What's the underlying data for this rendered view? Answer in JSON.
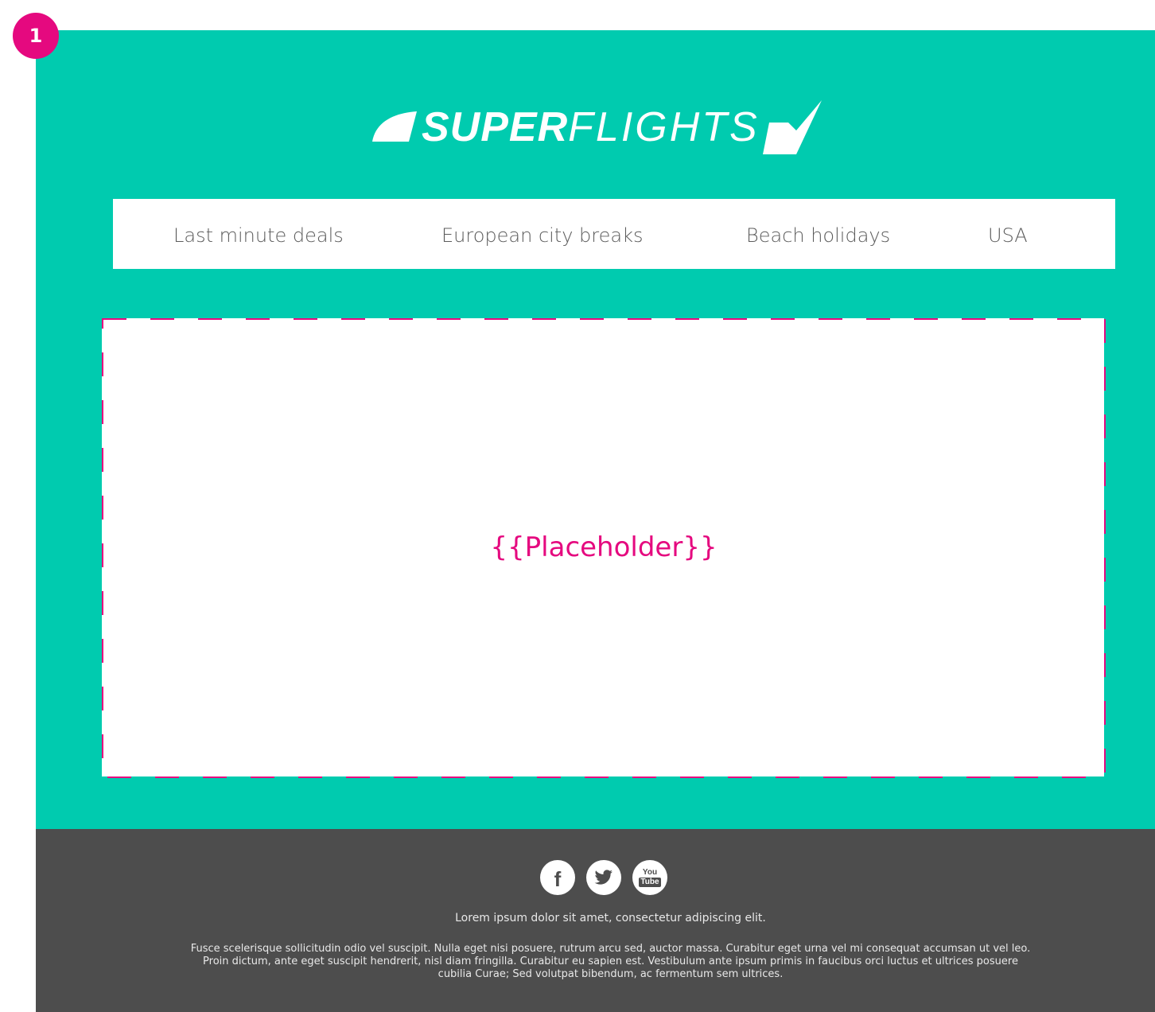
{
  "badge": {
    "number": "1"
  },
  "colors": {
    "teal": "#00cbaf",
    "accent_magenta": "#e5097f",
    "footer_bg": "#4d4d4d",
    "white": "#ffffff"
  },
  "header": {
    "logo": {
      "bold": "SUPER",
      "light": "FLIGHTS"
    }
  },
  "nav": {
    "items": [
      {
        "label": "Last minute deals"
      },
      {
        "label": "European city breaks"
      },
      {
        "label": "Beach holidays"
      },
      {
        "label": "USA"
      }
    ]
  },
  "main": {
    "placeholder": "{{Placeholder}}"
  },
  "footer": {
    "social": [
      {
        "icon": "facebook-icon",
        "glyph": "f"
      },
      {
        "icon": "twitter-icon"
      },
      {
        "icon": "youtube-icon",
        "top": "You",
        "bottom": "Tube"
      }
    ],
    "tagline": "Lorem ipsum dolor sit amet, consectetur adipiscing elit.",
    "body": "Fusce scelerisque sollicitudin odio vel suscipit. Nulla eget nisi posuere, rutrum arcu sed, auctor massa. Curabitur eget urna vel mi consequat accumsan ut vel leo. Proin dictum, ante eget suscipit hendrerit, nisl diam fringilla. Curabitur eu sapien est. Vestibulum ante ipsum primis in faucibus orci luctus et ultrices posuere cubilia Curae; Sed volutpat bibendum, ac fermentum sem ultrices."
  }
}
